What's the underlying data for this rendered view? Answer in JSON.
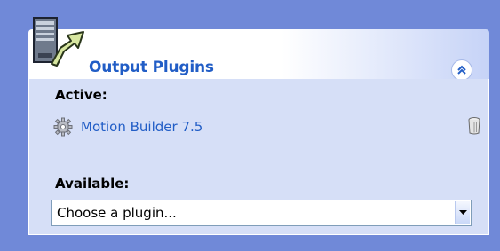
{
  "panel": {
    "title": "Output Plugins",
    "header_icon": "output-plugins-icon",
    "collapse_icon": "chevron-double-up-icon"
  },
  "active": {
    "label": "Active:",
    "plugins": [
      {
        "name": "Motion Builder 7.5",
        "icon": "gear-icon",
        "action_icon": "trash-icon"
      }
    ]
  },
  "available": {
    "label": "Available:",
    "select_value": "Choose a plugin..."
  },
  "colors": {
    "background": "#7089d8",
    "header_title": "#215dc6",
    "body_bg": "#d6dff7",
    "link": "#215dc6"
  }
}
